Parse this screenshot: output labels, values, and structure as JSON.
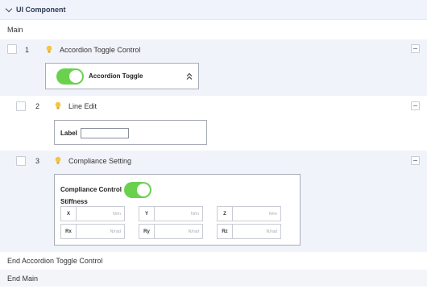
{
  "section": {
    "title": "UI Component"
  },
  "main": {
    "label": "Main",
    "end_label": "End Main"
  },
  "items": [
    {
      "num": "1",
      "title": "Accordion Toggle Control",
      "toggle_label": "Accordion Toggle",
      "toggle_on": true,
      "end_label": "End Accordion Toggle Control"
    },
    {
      "num": "2",
      "title": "Line Edit",
      "field_label": "Label",
      "field_value": ""
    },
    {
      "num": "3",
      "title": "Compliance Setting",
      "control_label": "Compliance Control",
      "toggle_on": true,
      "stiffness_label": "Stiffness",
      "fields": [
        {
          "label": "X",
          "unit": "N/m"
        },
        {
          "label": "Y",
          "unit": "N/m"
        },
        {
          "label": "Z",
          "unit": "N/m"
        },
        {
          "label": "Rx",
          "unit": "N/rad"
        },
        {
          "label": "Ry",
          "unit": "N/rad"
        },
        {
          "label": "Rz",
          "unit": "N/rad"
        }
      ]
    }
  ],
  "colors": {
    "toggle_on": "#6ad14f",
    "bulb": "#f5c542",
    "header_bg": "#f0f3fb",
    "band_bg": "#f1f3fa"
  },
  "icons": {
    "collapse": "chevron-down-icon",
    "bulb": "lightbulb-icon",
    "accordion": "double-chevron-up-icon",
    "minus": "minus-icon"
  }
}
